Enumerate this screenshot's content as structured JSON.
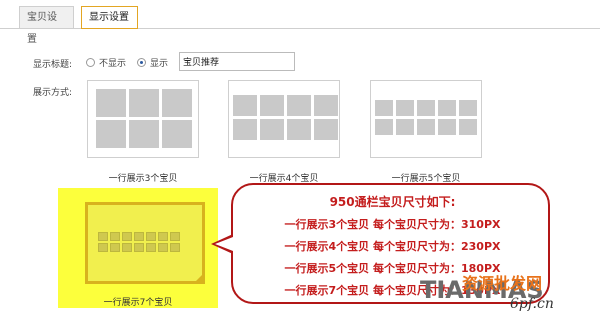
{
  "tabs": [
    {
      "label": "宝贝设置",
      "active": false
    },
    {
      "label": "显示设置",
      "active": true
    }
  ],
  "title_field": {
    "label": "显示标题:",
    "options": [
      "不显示",
      "显示"
    ],
    "selected": "显示",
    "value": "宝贝推荐"
  },
  "display_mode": {
    "label": "展示方式:",
    "options": [
      {
        "caption": "一行展示3个宝贝"
      },
      {
        "caption": "一行展示4个宝贝"
      },
      {
        "caption": "一行展示5个宝贝"
      },
      {
        "caption": "一行展示7个宝贝",
        "selected": true
      }
    ]
  },
  "bubble": {
    "title": "950通栏宝贝尺寸如下:",
    "lines": [
      "一行展示3个宝贝 每个宝贝尺寸为：310PX",
      "一行展示4个宝贝 每个宝贝尺寸为：230PX",
      "一行展示5个宝贝 每个宝贝尺寸为：180PX",
      "一行展示7个宝贝 每个宝贝尺寸为：130PX"
    ]
  },
  "watermark": {
    "en": "TIANMAS",
    "cn": "资源批发网",
    "url": "6pf.cn"
  },
  "colors": {
    "accent_red": "#c41d1d",
    "highlight_yellow": "#fcff3c",
    "selected_border": "#d8b21e"
  }
}
